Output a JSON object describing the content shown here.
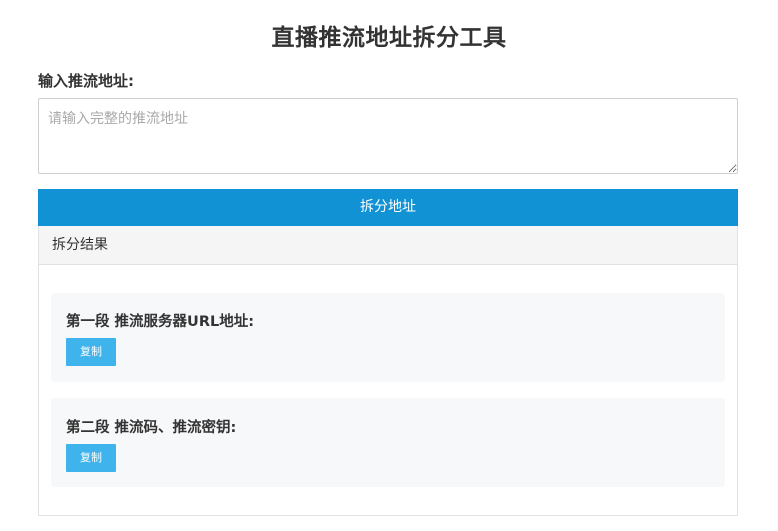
{
  "page": {
    "title": "直播推流地址拆分工具"
  },
  "input": {
    "label": "输入推流地址:",
    "placeholder": "请输入完整的推流地址",
    "value": ""
  },
  "actions": {
    "split_label": "拆分地址"
  },
  "result": {
    "header": "拆分结果",
    "segments": [
      {
        "title": "第一段 推流服务器URL地址:",
        "copy_label": "复制"
      },
      {
        "title": "第二段 推流码、推流密钥:",
        "copy_label": "复制"
      }
    ]
  },
  "colors": {
    "primary_button": "#1192d5",
    "copy_button": "#3fb3ec",
    "card_background": "#f7f8fa",
    "panel_header_background": "#f5f5f5"
  }
}
